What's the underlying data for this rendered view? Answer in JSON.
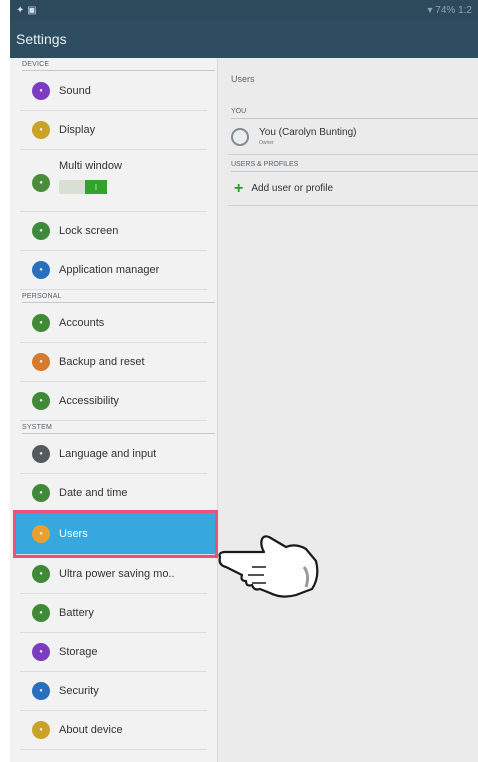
{
  "statusbar": {
    "left": "✦ ▣",
    "right": "▾ 74% 1:2"
  },
  "titlebar": {
    "title": "Settings"
  },
  "sidebar": {
    "sections": [
      {
        "header": "DEVICE",
        "items": [
          {
            "label": "Sound",
            "color": "#7b3cc2",
            "icon": "sound-icon"
          },
          {
            "label": "Display",
            "color": "#c9a227",
            "icon": "display-icon"
          },
          {
            "label": "Multi window",
            "color": "#4a8c3a",
            "icon": "multi-window-icon",
            "toggle": "I"
          },
          {
            "label": "Lock screen",
            "color": "#3f8a3a",
            "icon": "lock-icon"
          },
          {
            "label": "Application manager",
            "color": "#2a6fbf",
            "icon": "apps-icon"
          }
        ]
      },
      {
        "header": "PERSONAL",
        "items": [
          {
            "label": "Accounts",
            "color": "#3e8a36",
            "icon": "key-icon"
          },
          {
            "label": "Backup and reset",
            "color": "#d67a2e",
            "icon": "backup-icon"
          },
          {
            "label": "Accessibility",
            "color": "#3e8a36",
            "icon": "accessibility-icon"
          }
        ]
      },
      {
        "header": "SYSTEM",
        "items": [
          {
            "label": "Language and input",
            "color": "#555a5f",
            "icon": "language-icon"
          },
          {
            "label": "Date and time",
            "color": "#3e8a36",
            "icon": "clock-icon"
          },
          {
            "label": "Users",
            "color": "#e8a030",
            "icon": "users-icon",
            "active": true
          },
          {
            "label": "Ultra power saving mo..",
            "color": "#3e8a36",
            "icon": "power-saving-icon"
          },
          {
            "label": "Battery",
            "color": "#3e8a36",
            "icon": "battery-icon"
          },
          {
            "label": "Storage",
            "color": "#7b3cc2",
            "icon": "storage-icon"
          },
          {
            "label": "Security",
            "color": "#2a6fbf",
            "icon": "security-icon"
          },
          {
            "label": "About device",
            "color": "#c9a227",
            "icon": "info-icon"
          }
        ]
      }
    ]
  },
  "main": {
    "title": "Users",
    "you_header": "YOU",
    "user": {
      "name": "You (Carolyn Bunting)",
      "role": "Owner"
    },
    "profiles_header": "USERS & PROFILES",
    "add_label": "Add user or profile"
  }
}
